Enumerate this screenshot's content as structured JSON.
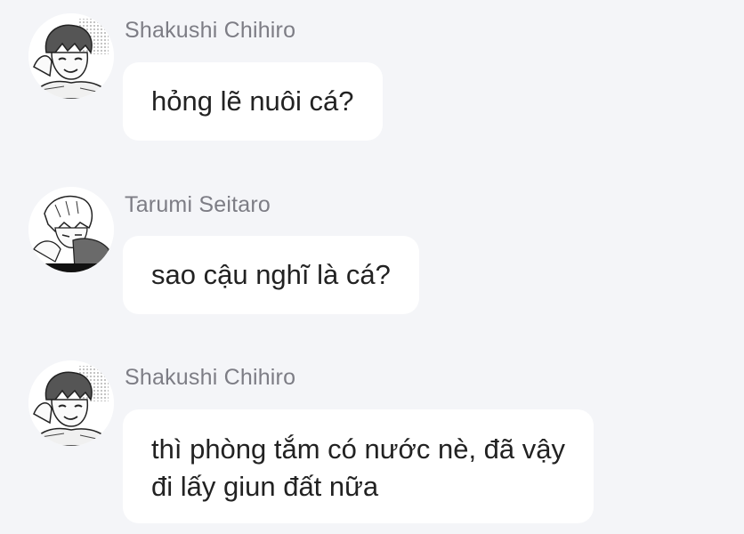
{
  "messages": [
    {
      "sender": "Shakushi Chihiro",
      "avatar_icon": "manga-boy-avatar-icon",
      "lines": [
        "hỏng lẽ nuôi cá?"
      ]
    },
    {
      "sender": "Tarumi Seitaro",
      "avatar_icon": "manga-boy-bowed-head-avatar-icon",
      "lines": [
        "sao cậu nghĩ là cá?"
      ]
    },
    {
      "sender": "Shakushi Chihiro",
      "avatar_icon": "manga-boy-avatar-icon",
      "lines": [
        "thì phòng tắm có nước nè, đã vậy",
        "đi lấy giun đất nữa"
      ]
    }
  ],
  "colors": {
    "background": "#f4f5f8",
    "bubble": "#ffffff",
    "sender_name": "#7d7d85",
    "message_text": "#222222"
  }
}
